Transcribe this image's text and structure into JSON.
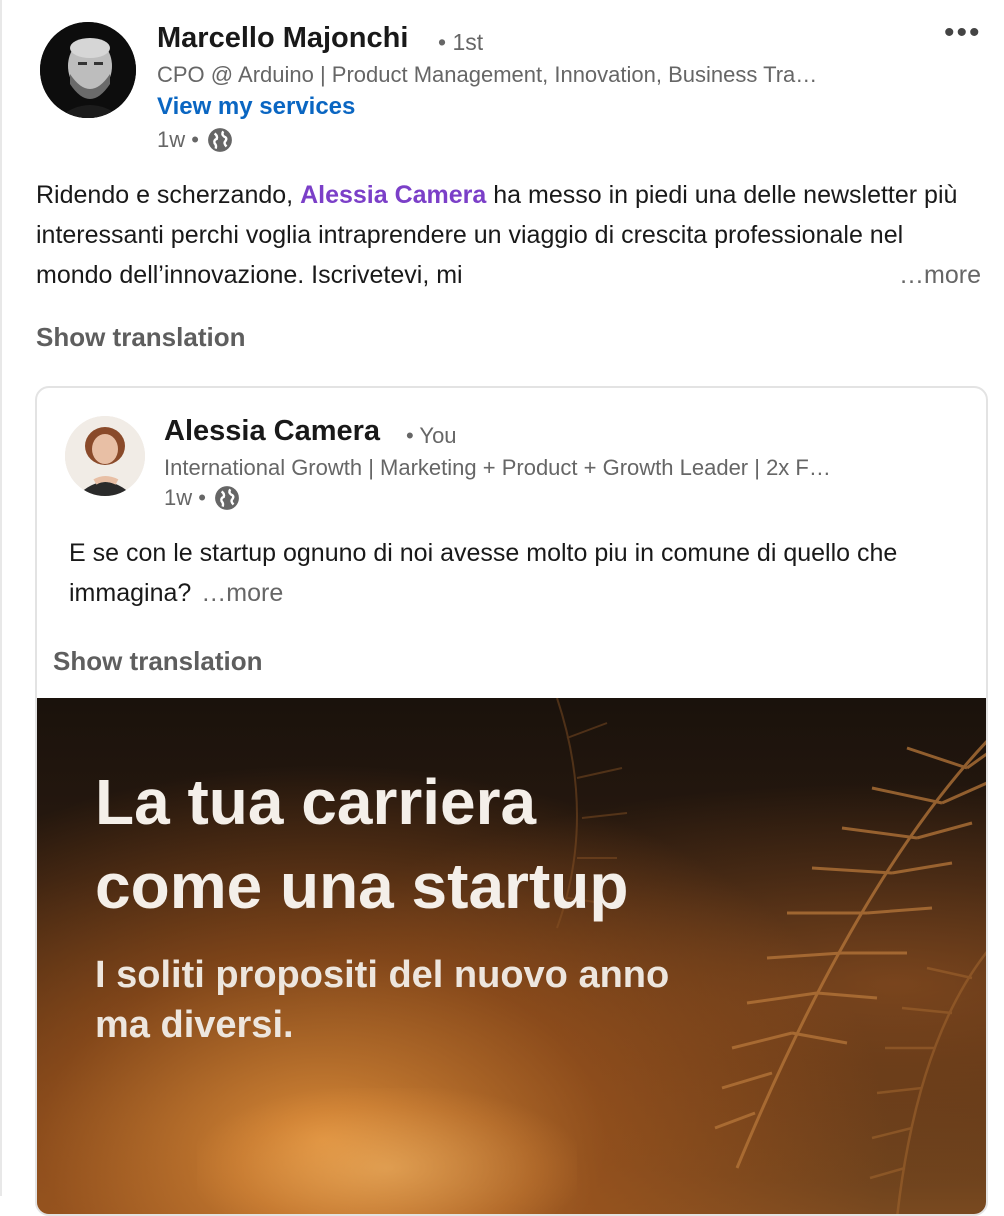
{
  "post": {
    "author": {
      "name": "Marcello Majonchi",
      "degree": "• 1st",
      "headline": "CPO @ Arduino | Product Management, Innovation, Business Tra…",
      "services_link": "View my services",
      "time": "1w •"
    },
    "text": {
      "before": "Ridendo e scherzando, ",
      "mention": "Alessia Camera",
      "after": " ha messo in piedi una delle newsletter più interessanti perchi voglia intraprendere un viaggio di crescita professionale nel mondo dell’innovazione. Iscrivetevi, mi",
      "more": "…more"
    },
    "show_translation": "Show translation",
    "menu_icon": "more-horizontal-icon"
  },
  "shared": {
    "author": {
      "name": "Alessia Camera",
      "relation": "• You",
      "headline": "International Growth | Marketing + Product + Growth Leader | 2x F…",
      "time": "1w •"
    },
    "text": "E se con le startup ognuno di noi avesse molto piu in comune di quello che immagina?",
    "more": "…more",
    "show_translation": "Show translation",
    "image": {
      "title_line1": "La tua carriera",
      "title_line2": "come una startup",
      "subtitle_line1": "I soliti propositi del nuovo anno",
      "subtitle_line2": "ma diversi."
    }
  },
  "colors": {
    "link_blue": "#0a66c2",
    "mention_purple": "#7b3fc8",
    "muted": "#666666"
  }
}
